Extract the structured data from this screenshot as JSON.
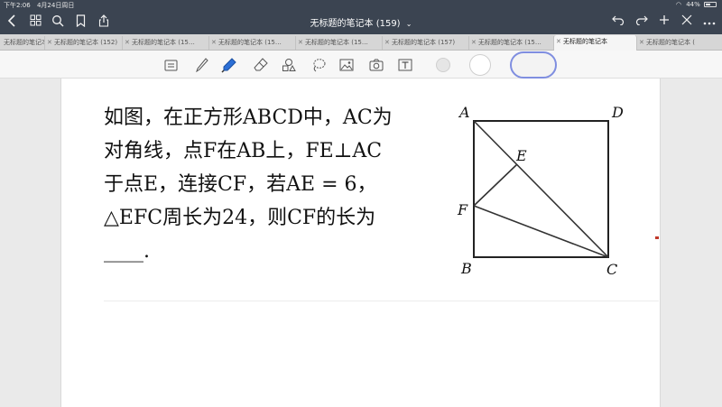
{
  "status_bar": {
    "time": "下午2:06",
    "date": "4月24日周日",
    "battery": "44%"
  },
  "title_bar": {
    "title": "无标题的笔记本 (159)"
  },
  "tabs": [
    {
      "label": "无标题的笔记本 (151)",
      "active": false
    },
    {
      "label": "无标题的笔记本 (152)",
      "active": false
    },
    {
      "label": "无标题的笔记本 (15…",
      "active": false
    },
    {
      "label": "无标题的笔记本 (15…",
      "active": false
    },
    {
      "label": "无标题的笔记本 (15…",
      "active": false
    },
    {
      "label": "无标题的笔记本 (157)",
      "active": false
    },
    {
      "label": "无标题的笔记本 (15…",
      "active": false
    },
    {
      "label": "无标题的笔记本",
      "active": true
    },
    {
      "label": "无标题的笔记本 (15…",
      "active": false
    }
  ],
  "toolbar": {
    "tools": [
      "keyboard-icon",
      "pen-icon",
      "highlighter-icon",
      "eraser-icon",
      "shapes-icon",
      "lasso-icon",
      "image-icon",
      "camera-icon",
      "text-icon"
    ],
    "colors": [
      "#d8d8d8",
      "#ffffff",
      "#7f8ee0"
    ]
  },
  "problem": {
    "lines": [
      "如图，在正方形ABCD中，AC为",
      "对角线，点F在AB上，FE⊥AC",
      "于点E，连接CF，若AE = 6，",
      "△EFC周长为24，则CF的长为",
      "____."
    ]
  },
  "figure": {
    "labels": {
      "A": "A",
      "B": "B",
      "C": "C",
      "D": "D",
      "E": "E",
      "F": "F"
    }
  }
}
